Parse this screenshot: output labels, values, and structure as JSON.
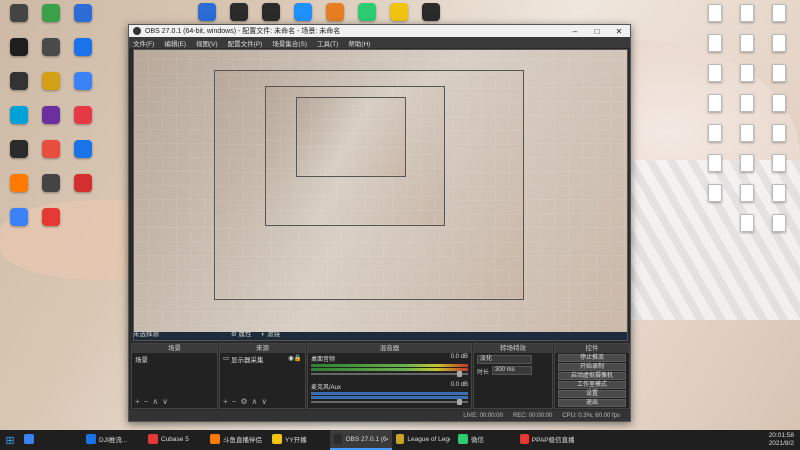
{
  "desktop": {
    "icons_left": [
      {
        "label": "",
        "color": "#444"
      },
      {
        "label": "",
        "color": "#3aa04a"
      },
      {
        "label": "",
        "color": "#2d6cd6"
      },
      {
        "label": "",
        "color": "#1e1e1e"
      },
      {
        "label": "",
        "color": "#4a4a4a"
      },
      {
        "label": "",
        "color": "#1a73e8"
      },
      {
        "label": "",
        "color": "#333"
      },
      {
        "label": "",
        "color": "#d4a017"
      },
      {
        "label": "",
        "color": "#3b82f6"
      },
      {
        "label": "",
        "color": "#00a1d6"
      },
      {
        "label": "",
        "color": "#6b2fa0"
      },
      {
        "label": "",
        "color": "#e63946"
      },
      {
        "label": "",
        "color": "#2b2b2b"
      },
      {
        "label": "",
        "color": "#e84d3d"
      },
      {
        "label": "",
        "color": "#1a73e8"
      },
      {
        "label": "",
        "color": "#ff7a00"
      },
      {
        "label": "",
        "color": "#444"
      },
      {
        "label": "",
        "color": "#d32f2f"
      },
      {
        "label": "",
        "color": "#3b82f6"
      },
      {
        "label": "",
        "color": "#e53935"
      }
    ],
    "icons_top": [
      {
        "label": "",
        "color": "#2d6cd6"
      },
      {
        "label": "",
        "color": "#2b2b2b"
      },
      {
        "label": "",
        "color": "#2b2b2b"
      },
      {
        "label": "",
        "color": "#1e90ff"
      },
      {
        "label": "",
        "color": "#e67e22"
      },
      {
        "label": "",
        "color": "#2ecc71"
      },
      {
        "label": "",
        "color": "#f1c40f"
      },
      {
        "label": "",
        "color": "#2b2b2b"
      }
    ]
  },
  "obs": {
    "title": "OBS 27.0.1 (64-bit, windows) - 配置文件: 未命名 - 场景: 未命名",
    "menu": [
      "文件(F)",
      "编辑(E)",
      "视图(V)",
      "配置文件(P)",
      "场景集合(S)",
      "工具(T)",
      "帮助(H)"
    ],
    "status_left": "未选择源",
    "props_button": "属性",
    "filters_button": "滤镜",
    "docks": {
      "scenes": {
        "header": "场景",
        "item": "场景"
      },
      "sources": {
        "header": "来源",
        "item": "显示器采集"
      },
      "mixer": {
        "header": "混音器",
        "channels": [
          {
            "name": "桌面音频",
            "level": "0.0 dB"
          },
          {
            "name": "麦克风/Aux",
            "level": "0.0 dB"
          }
        ]
      },
      "transitions": {
        "header": "转场特效",
        "type": "淡化",
        "duration_label": "时长",
        "duration_value": "300 ms"
      },
      "controls": {
        "header": "控件",
        "buttons": [
          "停止推流",
          "开始录制",
          "启动虚拟摄像机",
          "工作室模式",
          "设置",
          "退出"
        ]
      }
    },
    "statusbar": {
      "live": "LIVE: 00:00:00",
      "rec": "REC: 00:00:00",
      "cpu": "CPU: 0.3%, 60.00 fps"
    }
  },
  "taskbar": {
    "items": [
      {
        "label": "",
        "active": false,
        "color": "#3b82f6"
      },
      {
        "label": "DJI推流...",
        "active": false,
        "color": "#1a73e8"
      },
      {
        "label": "Cubase 5",
        "active": false,
        "color": "#e53935"
      },
      {
        "label": "斗鱼直播伴侣",
        "active": false,
        "color": "#ff7a00"
      },
      {
        "label": "YY开播",
        "active": false,
        "color": "#f1c40f"
      },
      {
        "label": "OBS 27.0.1 (64...",
        "active": true,
        "color": "#2b2b2b"
      },
      {
        "label": "League of Lege...",
        "active": false,
        "color": "#c9a227"
      },
      {
        "label": "微信",
        "active": false,
        "color": "#2ecc71"
      },
      {
        "label": "PPAP极信直播...",
        "active": false,
        "color": "#e53935"
      }
    ],
    "time": "20:01:58",
    "date": "2021/8/2"
  }
}
